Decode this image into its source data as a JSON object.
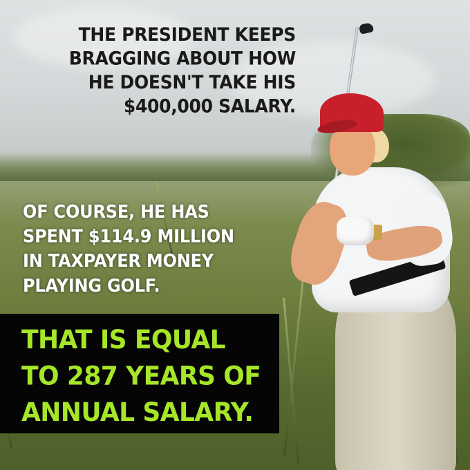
{
  "headline": {
    "text": "THE PRESIDENT KEEPS\nBRAGGING ABOUT HOW\nHE DOESN'T TAKE HIS\n$400,000 SALARY."
  },
  "middle_text": {
    "text": "OF COURSE, HE HAS\nSPENT $114.9 MILLION\nIN TAXPAYER MONEY\nPLAYING GOLF."
  },
  "callout": {
    "text": "THAT IS EQUAL\nTO 287 YEARS OF\nANNUAL SALARY.",
    "text_color": "#a6e628",
    "background_color": "#050505"
  },
  "photo": {
    "subject": "golfer-in-red-cap-and-white-polo",
    "setting": "tall-grass-golf-rough",
    "cap_color": "#c8202a"
  }
}
